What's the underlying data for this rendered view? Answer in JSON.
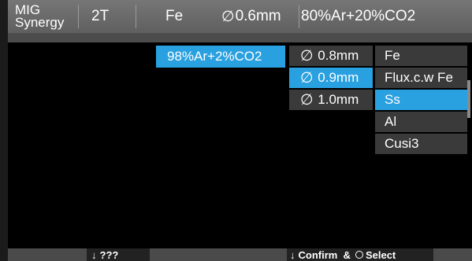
{
  "header": {
    "mode_line1": "MIG",
    "mode_line2": "Synergy",
    "trigger": "2T",
    "material": "Fe",
    "wire_symbol": "∅",
    "wire_size": "0.6mm",
    "gas": "80%Ar+20%CO2"
  },
  "menus": {
    "gas_option": "98%Ar+2%CO2",
    "wire_options": [
      {
        "symbol": "∅",
        "label": "0.8mm",
        "selected": false
      },
      {
        "symbol": "∅",
        "label": "0.9mm",
        "selected": true
      },
      {
        "symbol": "∅",
        "label": "1.0mm",
        "selected": false
      }
    ],
    "material_options": [
      {
        "label": "Fe",
        "selected": false
      },
      {
        "label": "Flux.c.w Fe",
        "selected": false
      },
      {
        "label": "Ss",
        "selected": true
      },
      {
        "label": "Al",
        "selected": false
      },
      {
        "label": "Cusi3",
        "selected": false
      }
    ]
  },
  "footer": {
    "left_text": "???",
    "confirm_text": "Confirm  &",
    "select_text": "Select"
  },
  "colors": {
    "accent": "#29a0e0",
    "menu_bg": "#3a3a3a",
    "header_bg": "#6a6a6a"
  }
}
